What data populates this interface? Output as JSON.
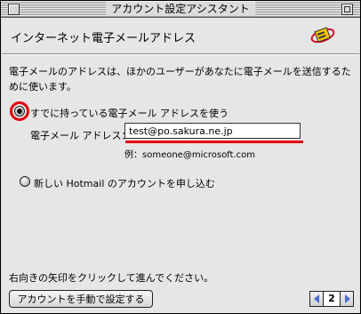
{
  "window": {
    "title": "アカウント設定アシスタント"
  },
  "header": {
    "title": "インターネット電子メールアドレス",
    "icon": "email-envelope-icon"
  },
  "content": {
    "intro": "電子メールのアドレスは、ほかのユーザーがあなたに電子メールを送信するために使います。",
    "option_existing": {
      "label": "すでに持っている電子メール アドレスを使う",
      "selected": true
    },
    "email_label": "電子メール アドレス：",
    "email_value": "test@po.sakura.ne.jp",
    "example": "例：someone@microsoft.com",
    "option_hotmail": {
      "label": "新しい Hotmail のアカウントを申し込む",
      "selected": false
    },
    "footer_instruction": "右向きの矢印をクリックして進んでください。"
  },
  "bottom": {
    "manual_button": "アカウントを手動で設定する",
    "page_number": "2"
  },
  "colors": {
    "highlight_red": "#e3000f",
    "nav_arrow": "#4a6fd1"
  }
}
